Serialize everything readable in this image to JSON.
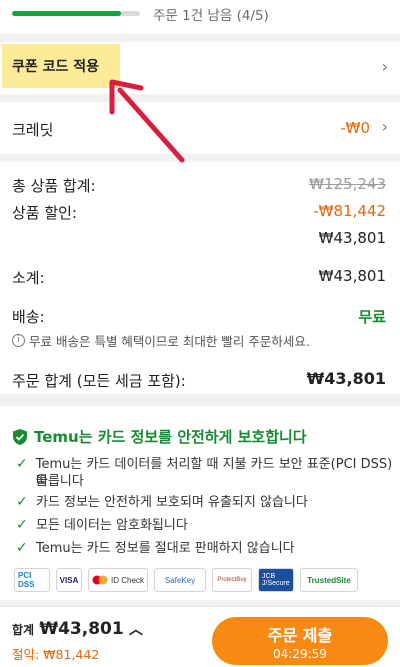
{
  "progress": {
    "text": "주문 1건 남음 (4/5)",
    "fraction": 0.85
  },
  "coupon": {
    "label": "쿠폰 코드 적용"
  },
  "credit": {
    "label": "크레딧",
    "value": "-₩0"
  },
  "summary": {
    "total_label": "총 상품 합계:",
    "total_value": "₩125,243",
    "discount_label": "상품 할인:",
    "discount_value": "-₩81,442",
    "after_discount": "₩43,801",
    "subtotal_label": "소계:",
    "subtotal_value": "₩43,801",
    "shipping_label": "배송:",
    "shipping_value": "무료",
    "shipping_note": "무료 배송은 특별 혜택이므로 최대한 빨리 주문하세요.",
    "order_total_label": "주문 합계 (모든 세금 포함):",
    "order_total_value": "₩43,801"
  },
  "security": {
    "title": "Temu는 카드 정보를 안전하게 보호합니다",
    "items": [
      "Temu는 카드 데이터를 처리할 때 지불 카드 보안 표준(PCI DSS)을",
      "따릅니다",
      "카드 정보는 안전하게 보호되며 유출되지 않습니다",
      "모든 데이터는 암호화됩니다",
      "Temu는 카드 정보를 절대로 판매하지 않습니다"
    ],
    "badges": [
      "PCI DSS",
      "VISA",
      "ID Check",
      "SafeKey",
      "ProtectBuy",
      "JCB J/Secure",
      "TrustedSite"
    ]
  },
  "bottom": {
    "total_prefix": "합계",
    "total_value": "₩43,801",
    "savings": "절약: ₩81,442",
    "submit_label": "주문 제출",
    "timer": "04:29:59"
  },
  "colors": {
    "accent": "#f78a13",
    "green": "#178a32",
    "orange_text": "#e5670c",
    "highlight": "#fcec9a",
    "arrow": "#d81f3f"
  }
}
